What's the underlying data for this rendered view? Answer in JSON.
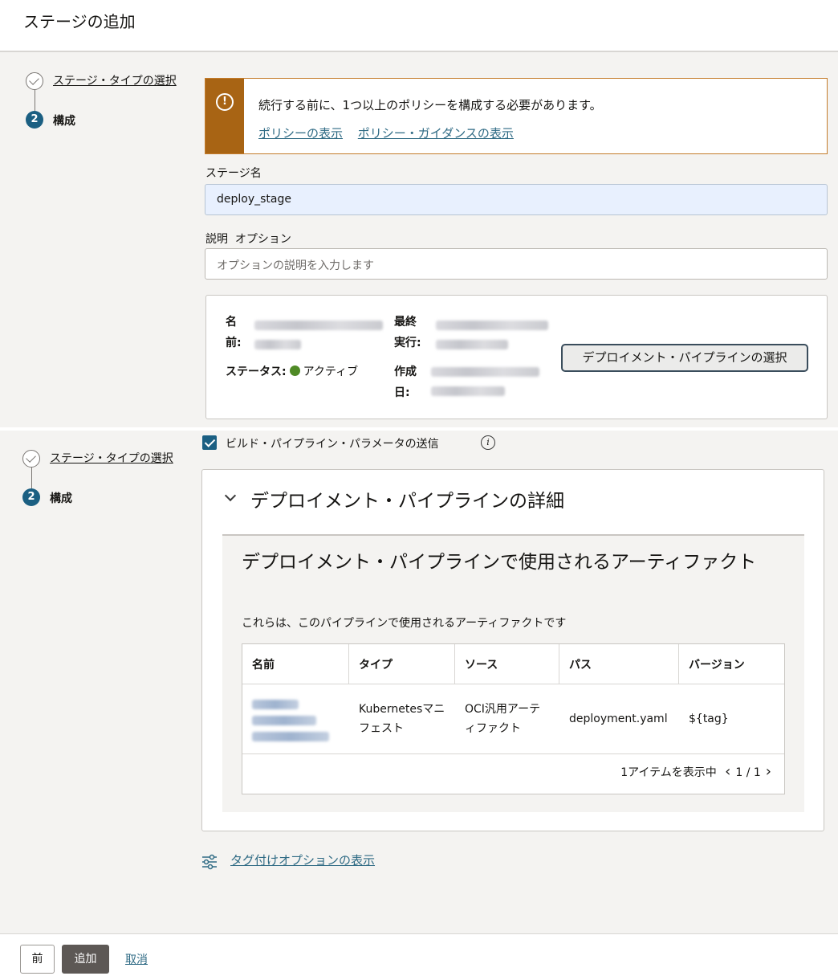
{
  "header": {
    "title": "ステージの追加"
  },
  "steps": {
    "step1_label": "ステージ・タイプの選択",
    "step2_num": "2",
    "step2_label": "構成"
  },
  "warning": {
    "icon": "!",
    "message": "続行する前に、1つ以上のポリシーを構成する必要があります。",
    "link_policies": "ポリシーの表示",
    "link_guidance": "ポリシー・ガイダンスの表示"
  },
  "form": {
    "stage_name_label": "ステージ名",
    "stage_name_value": "deploy_stage",
    "description_label": "説明",
    "description_optional": "オプション",
    "description_placeholder": "オプションの説明を入力します"
  },
  "pipeline": {
    "name_label": "名前:",
    "last_run_label": "最終実行:",
    "status_label": "ステータス:",
    "status_value": "アクティブ",
    "status_color": "#4f8a26",
    "created_label": "作成日:",
    "select_button": "デプロイメント・パイプラインの選択"
  },
  "send_params": {
    "label": "ビルド・パイプライン・パラメータの送信",
    "checked": true
  },
  "details": {
    "title": "デプロイメント・パイプラインの詳細",
    "artifacts_title": "デプロイメント・パイプラインで使用されるアーティファクト",
    "artifacts_subtitle": "これらは、このパイプラインで使用されるアーティファクトです",
    "table": {
      "headers": [
        "名前",
        "タイプ",
        "ソース",
        "パス",
        "バージョン"
      ],
      "rows": [
        {
          "type": "Kubernetesマニフェスト",
          "source": "OCI汎用アーティファクト",
          "path": "deployment.yaml",
          "version": "${tag}"
        }
      ]
    },
    "pager_text": "1アイテムを表示中",
    "pager_page": "1 / 1"
  },
  "tagging": {
    "link": "タグ付けオプションの表示"
  },
  "footer": {
    "prev": "前",
    "add": "追加",
    "cancel": "取消"
  }
}
